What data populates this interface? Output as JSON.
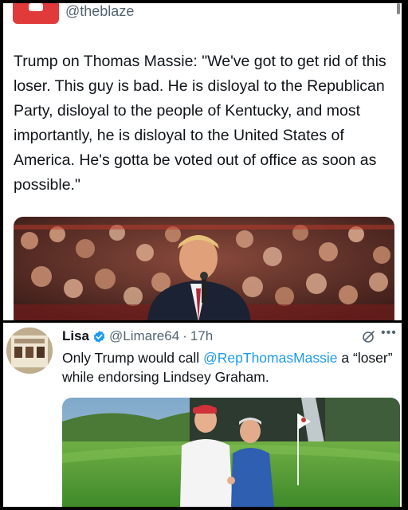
{
  "top_tweet": {
    "handle": "@theblaze",
    "text": "Trump on Thomas Massie: \"We've got to get rid of this loser. This guy is bad. He is disloyal to the Republican Party, disloyal to the people of Kentucky, and most importantly, he is disloyal to the United States of America. He's gotta be voted out of office as soon as possible.\"",
    "photo_icon": "rally-photo"
  },
  "reply_tweet": {
    "display_name": "Lisa",
    "handle": "@Limare64",
    "separator": "·",
    "time": "17h",
    "text_before": "Only Trump would call ",
    "mention": "@RepThomasMassie",
    "text_after": " a “loser” while endorsing Lindsey Graham.",
    "verified_color": "#1d9bf0",
    "photo_icon": "golf-photo"
  },
  "colors": {
    "link": "#1d9bf0",
    "brand_red": "#e03a3a",
    "secondary_text": "#536471"
  }
}
